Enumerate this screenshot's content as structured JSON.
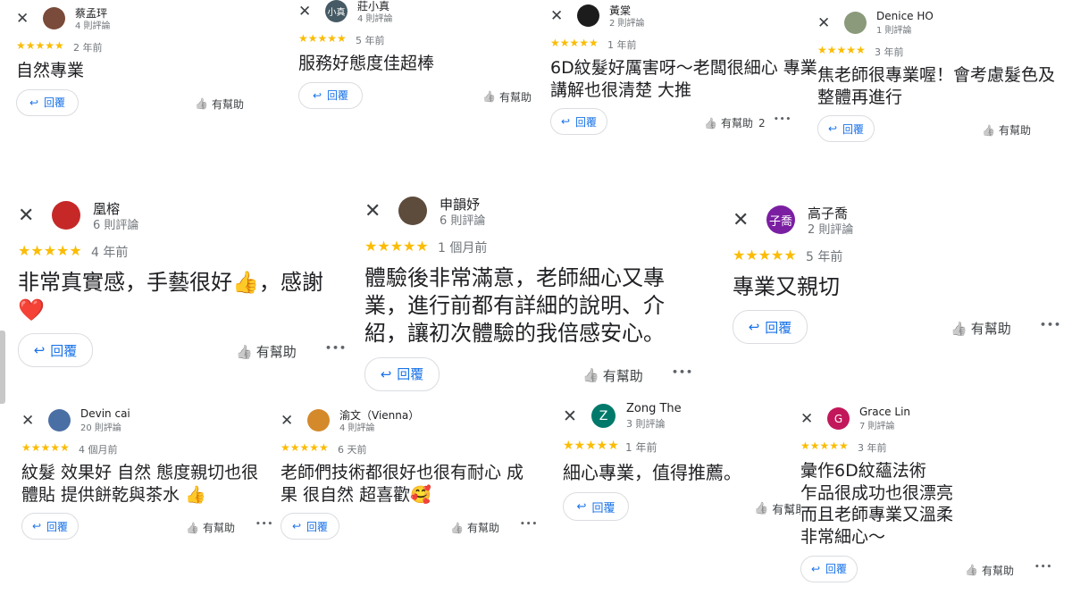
{
  "common": {
    "reply_label": "回覆",
    "helpful_label": "有幫助",
    "close_glyph": "✕",
    "reply_glyph": "↩",
    "thumb_glyph": "👍",
    "more_glyph": "•••",
    "stars": "★★★★★",
    "star_color": "#fbbc04",
    "accent": "#1a73e8"
  },
  "reviews": [
    {
      "name": "蔡孟玶",
      "count": "4 則評論",
      "date": "2 年前",
      "text": "自然專業",
      "helpful_count": "",
      "avatar_text": "",
      "avatar_color": "#7a4a3a",
      "avatar_icon": "person-photo"
    },
    {
      "name": "莊小真",
      "count": "4 則評論",
      "date": "5 年前",
      "text": "服務好態度佳超棒",
      "helpful_count": "",
      "avatar_text": "小真",
      "avatar_color": "#455a64",
      "avatar_icon": "initials"
    },
    {
      "name": "黃棠",
      "count": "2 則評論",
      "date": "1 年前",
      "text": "6D紋髮好厲害呀～老闆很細心 專業\n講解也很清楚 大推",
      "helpful_count": "2",
      "avatar_text": "",
      "avatar_color": "#1c1c1c",
      "avatar_icon": "person-photo"
    },
    {
      "name": "Denice HO",
      "count": "1 則評論",
      "date": "3 年前",
      "text": "焦老師很專業喔！會考慮髮色及\n整體再進行",
      "helpful_count": "",
      "avatar_text": "",
      "avatar_color": "#8a9a7a",
      "avatar_icon": "landscape-photo"
    },
    {
      "name": "凰榕",
      "count": "6 則評論",
      "date": "4 年前",
      "text": "非常真實感，手藝很好👍，感謝\n❤️",
      "helpful_count": "",
      "avatar_text": "",
      "avatar_color": "#c62828",
      "avatar_icon": "person-photo"
    },
    {
      "name": "申韻妤",
      "count": "6 則評論",
      "date": "1 個月前",
      "text": "體驗後非常滿意，老師細心又專\n業，進行前都有詳細的說明、介\n紹，讓初次體驗的我倍感安心。",
      "helpful_count": "",
      "avatar_text": "",
      "avatar_color": "#5d4b3c",
      "avatar_icon": "person-photo"
    },
    {
      "name": "高子喬",
      "count": "2 則評論",
      "date": "5 年前",
      "text": "專業又親切",
      "helpful_count": "",
      "avatar_text": "子喬",
      "avatar_color": "#7b1fa2",
      "avatar_icon": "initials"
    },
    {
      "name": "Devin cai",
      "count": "20 則評論",
      "date": "4 個月前",
      "text": "紋髮 效果好 自然 態度親切也很\n體貼 提供餅乾與茶水 👍",
      "helpful_count": "",
      "avatar_text": "",
      "avatar_color": "#4a6fa5",
      "avatar_icon": "person-photo"
    },
    {
      "name": "渝文（Vienna）",
      "count": "4 則評論",
      "date": "6 天前",
      "text": "老師們技術都很好也很有耐心 成\n果 很自然 超喜歡🥰",
      "helpful_count": "",
      "avatar_text": "",
      "avatar_color": "#d4892b",
      "avatar_icon": "dog-photo"
    },
    {
      "name": "Zong The",
      "count": "3 則評論",
      "date": "1 年前",
      "text": "細心專業，值得推薦。",
      "helpful_count": "",
      "avatar_text": "Z",
      "avatar_color": "#00796b",
      "avatar_icon": "initials"
    },
    {
      "name": "Grace Lin",
      "count": "7 則評論",
      "date": "3 年前",
      "text": "彙作6D紋蘊法術\n乍品很成功也很漂亮\n而且老師專業又溫柔\n非常細心～",
      "helpful_count": "",
      "avatar_text": "G",
      "avatar_color": "#c2185b",
      "avatar_icon": "initials"
    }
  ]
}
